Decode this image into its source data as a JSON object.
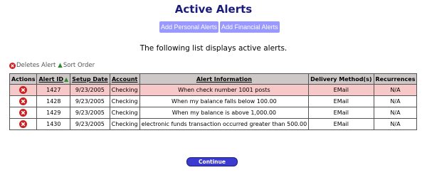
{
  "page": {
    "title": "Active Alerts",
    "intro": "The following list displays active alerts."
  },
  "buttons": {
    "personal": "Add Personal Alerts",
    "financial": "Add Financial Alerts",
    "continue": "Continue"
  },
  "legend": {
    "delete_text": "Deletes Alert",
    "sort_text": "Sort Order"
  },
  "table": {
    "headers": [
      "Actions",
      "Alert ID",
      "Setup Date",
      "Account",
      "Alert Information",
      "Delivery Method(s)",
      "Recurrences"
    ],
    "rows": [
      {
        "id": "1427",
        "date": "9/23/2005",
        "account": "Checking",
        "info": "When check number 1001 posts",
        "method": "EMail",
        "recurrences": "N/A"
      },
      {
        "id": "1428",
        "date": "9/23/2005",
        "account": "Checking",
        "info": "When my balance falls below 100.00",
        "method": "EMail",
        "recurrences": "N/A"
      },
      {
        "id": "1429",
        "date": "9/23/2005",
        "account": "Checking",
        "info": "When my balance is above 1,000.00",
        "method": "EMail",
        "recurrences": "N/A"
      },
      {
        "id": "1430",
        "date": "9/23/2005",
        "account": "Checking",
        "info": "electronic funds transaction occurred greater than 500.00",
        "method": "EMail",
        "recurrences": "N/A"
      }
    ]
  },
  "colors": {
    "title": "#1a1a7a",
    "top_button": "#9999ff",
    "header_bg": "#cfc8c8",
    "highlight_row": "#f7c8c8",
    "delete_icon": "#cc2222",
    "continue_button": "#3b3bd0"
  }
}
